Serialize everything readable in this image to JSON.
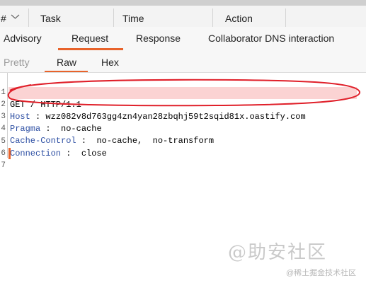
{
  "table_header": {
    "corner": "#",
    "columns": [
      "Task",
      "Time",
      "Action"
    ]
  },
  "main_tabs": [
    "Advisory",
    "Request",
    "Response",
    "Collaborator DNS interaction"
  ],
  "active_main_tab": "Request",
  "view_tabs": [
    "Pretty",
    "Raw",
    "Hex"
  ],
  "active_view_tab": "Raw",
  "request": {
    "line_numbers": [
      "1",
      "2",
      "3",
      "4",
      "5",
      "6",
      "7"
    ],
    "request_line": "GET / HTTP/1.1",
    "headers": [
      {
        "name": "Host",
        "value": "wzz082v8d763gg4zn4yan28zbqhj59t2sqid81x.oastify.com"
      },
      {
        "name": "Pragma",
        "value": "no-cache"
      },
      {
        "name": "Cache-Control",
        "value": "no-cache,  no-transform"
      },
      {
        "name": "Connection",
        "value": "close"
      }
    ]
  },
  "watermark": {
    "main": "@助安社区",
    "small": "@稀土掘金技术社区"
  },
  "colors": {
    "accent": "#e8632b",
    "highlight_row": "#fbd3d3",
    "annotation_ellipse": "#e0202a",
    "header_name": "#2d4fa3"
  }
}
